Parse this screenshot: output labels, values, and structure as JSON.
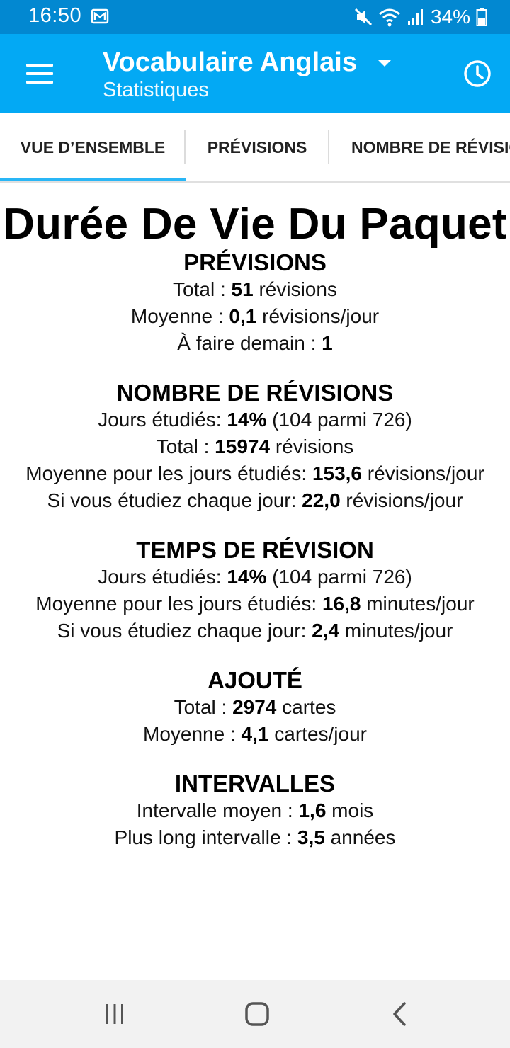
{
  "status_bar": {
    "time": "16:50",
    "battery": "34%",
    "icons": [
      "mail-icon",
      "mute-icon",
      "wifi-icon",
      "signal-icon",
      "battery-icon"
    ]
  },
  "app_bar": {
    "title": "Vocabulaire Anglais",
    "subtitle": "Statistiques",
    "icons": [
      "menu-icon",
      "dropdown-arrow-icon",
      "history-clock-icon"
    ]
  },
  "tabs": [
    {
      "label": "VUE D’ENSEMBLE",
      "selected": true
    },
    {
      "label": "PRÉVISIONS",
      "selected": false
    },
    {
      "label": "NOMBRE DE RÉVISIONS",
      "selected": false
    }
  ],
  "page_title": "Durée De Vie Du Paquet",
  "sections": [
    {
      "title": "PRÉVISIONS",
      "lines": [
        {
          "pre": "Total : ",
          "val": "51",
          "post": " révisions"
        },
        {
          "pre": "Moyenne : ",
          "val": "0,1",
          "post": " révisions/jour"
        },
        {
          "pre": "À faire demain : ",
          "val": "1",
          "post": ""
        }
      ]
    },
    {
      "title": "NOMBRE DE RÉVISIONS",
      "lines": [
        {
          "pre": "Jours étudiés: ",
          "val": "14%",
          "post": " (104 parmi 726)"
        },
        {
          "pre": "Total : ",
          "val": "15974",
          "post": " révisions"
        },
        {
          "pre": "Moyenne pour les jours étudiés: ",
          "val": "153,6",
          "post": " révisions/jour"
        },
        {
          "pre": "Si vous étudiez chaque jour: ",
          "val": "22,0",
          "post": " révisions/jour"
        }
      ]
    },
    {
      "title": "TEMPS DE RÉVISION",
      "lines": [
        {
          "pre": "Jours étudiés: ",
          "val": "14%",
          "post": " (104 parmi 726)"
        },
        {
          "pre": "Moyenne pour les jours étudiés: ",
          "val": "16,8",
          "post": " minutes/jour"
        },
        {
          "pre": "Si vous étudiez chaque jour: ",
          "val": "2,4",
          "post": " minutes/jour"
        }
      ]
    },
    {
      "title": "AJOUTÉ",
      "lines": [
        {
          "pre": "Total : ",
          "val": "2974",
          "post": " cartes"
        },
        {
          "pre": "Moyenne : ",
          "val": "4,1",
          "post": " cartes/jour"
        }
      ]
    },
    {
      "title": "INTERVALLES",
      "lines": [
        {
          "pre": "Intervalle moyen : ",
          "val": "1,6",
          "post": " mois"
        },
        {
          "pre": "Plus long intervalle : ",
          "val": "3,5",
          "post": " années"
        }
      ]
    }
  ],
  "nav_bar": {
    "icons": [
      "recent-apps-icon",
      "home-icon",
      "back-icon"
    ]
  },
  "colors": {
    "status_bar": "#0288d1",
    "app_bar": "#03a9f4",
    "tab_indicator": "#29b6f6",
    "nav_bar": "#f2f2f2"
  }
}
